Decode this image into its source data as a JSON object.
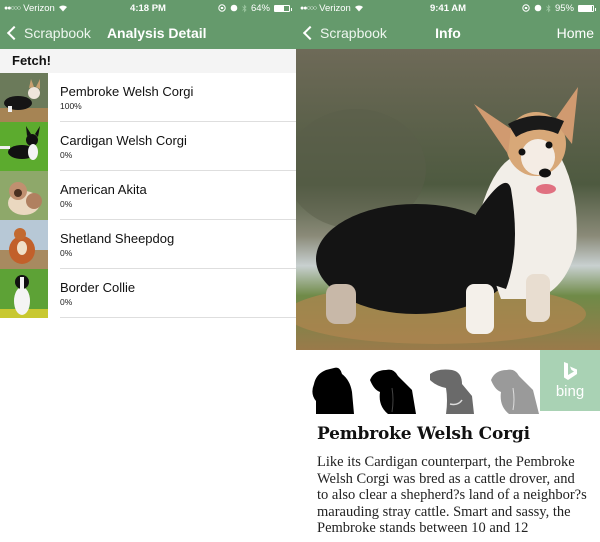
{
  "colors": {
    "nav_bg": "#659a6c",
    "bing_bg": "#a9d2b4"
  },
  "left": {
    "status": {
      "carrier": "Verizon",
      "signal_dots": "●●○○○",
      "time": "4:18 PM",
      "battery": "64%",
      "battery_level": 0.64
    },
    "nav": {
      "back_label": "Scrapbook",
      "title": "Analysis Detail"
    },
    "section_header": "Fetch!",
    "results": [
      {
        "name": "Pembroke Welsh Corgi",
        "score": "100%"
      },
      {
        "name": "Cardigan Welsh Corgi",
        "score": "0%"
      },
      {
        "name": "American Akita",
        "score": "0%"
      },
      {
        "name": "Shetland Sheepdog",
        "score": "0%"
      },
      {
        "name": "Border Collie",
        "score": "0%"
      }
    ]
  },
  "right": {
    "status": {
      "carrier": "Verizon",
      "signal_dots": "●●○○○",
      "time": "9:41 AM",
      "battery": "95%",
      "battery_level": 0.95
    },
    "nav": {
      "back_label": "Scrapbook",
      "title": "Info",
      "right_label": "Home"
    },
    "bing_label": "bing",
    "breed_icons": [
      "pomeranian-silhouette-icon",
      "spaniel-silhouette-icon",
      "hound-silhouette-icon",
      "basset-silhouette-icon"
    ],
    "breed": {
      "title": "Pembroke Welsh Corgi",
      "description": "Like its Cardigan counterpart, the Pembroke Welsh Corgi was bred as a cattle drover, and to also clear a shepherd?s land of a neighbor?s marauding stray cattle.  Smart and sassy, the Pembroke stands between 10 and 12"
    }
  }
}
